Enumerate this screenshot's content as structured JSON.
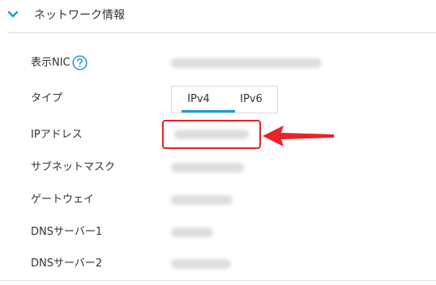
{
  "section": {
    "title": "ネットワーク情報",
    "expanded": true
  },
  "rows": [
    {
      "label": "表示NIC",
      "has_help": true
    },
    {
      "label": "タイプ"
    },
    {
      "label": "IPアドレス"
    },
    {
      "label": "サブネットマスク"
    },
    {
      "label": "ゲートウェイ"
    },
    {
      "label": "DNSサーバー1"
    },
    {
      "label": "DNSサーバー2"
    }
  ],
  "type_tabs": [
    {
      "label": "IPv4",
      "selected": true
    },
    {
      "label": "IPv6",
      "selected": false
    }
  ],
  "colors": {
    "accent": "#1a9ad6",
    "highlight": "#e8232a",
    "text": "#333333",
    "divider": "#dcdcdc"
  },
  "icons": {
    "expand": "chevron-down-icon",
    "help": "question-circle-icon",
    "annotation": "red-arrow-icon"
  }
}
